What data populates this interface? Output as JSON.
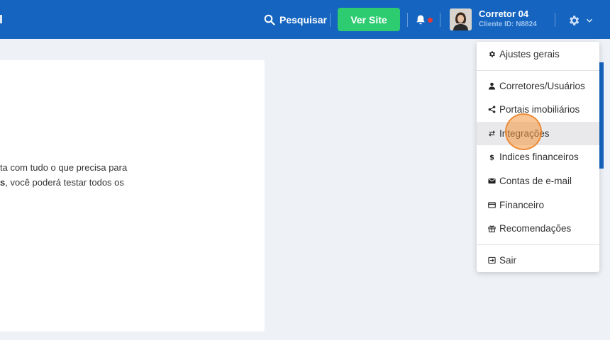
{
  "header": {
    "search_label": "Pesquisar",
    "ver_site_label": "Ver Site",
    "user_name": "Corretor 04",
    "client_id": "Cliente ID: N8824",
    "colors": {
      "bar": "#1565c0",
      "accent_green": "#2ecc71",
      "notification_dot": "#e53935"
    }
  },
  "content": {
    "line1": "ta com tudo o que precisa para",
    "line2_bold": "s",
    "line2_rest": ", você poderá testar todos os"
  },
  "menu": {
    "items": [
      {
        "label": "Ajustes gerais",
        "icon": "gear-icon"
      },
      {
        "label": "Corretores/Usuários",
        "icon": "user-icon"
      },
      {
        "label": "Portais imobiliários",
        "icon": "share-icon"
      },
      {
        "label": "Integrações",
        "icon": "swap-arrows-icon"
      },
      {
        "label": "Indices financeiros",
        "icon": "dollar-icon"
      },
      {
        "label": "Contas de e-mail",
        "icon": "envelope-icon"
      },
      {
        "label": "Financeiro",
        "icon": "credit-card-icon"
      },
      {
        "label": "Recomendações",
        "icon": "gift-icon"
      },
      {
        "label": "Sair",
        "icon": "sign-out-icon"
      }
    ],
    "highlighted_item": "Integrações"
  }
}
